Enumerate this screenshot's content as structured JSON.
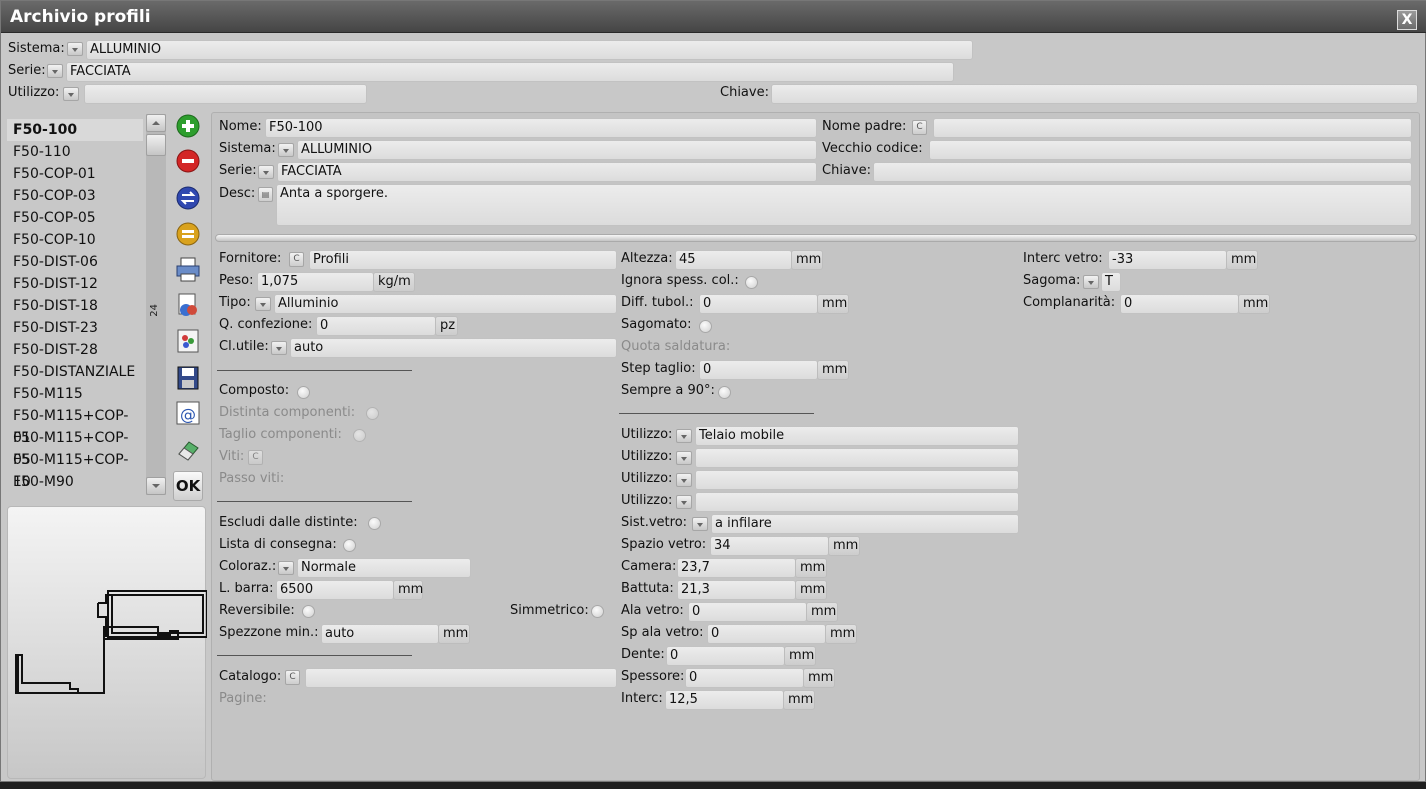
{
  "window": {
    "title": "Archivio profili",
    "close_glyph": "X"
  },
  "filters": {
    "sistema_label": "Sistema:",
    "sistema_value": "ALLUMINIO",
    "serie_label": "Serie:",
    "serie_value": "FACCIATA",
    "utilizzo_label": "Utilizzo:",
    "utilizzo_value": "",
    "chiave_label": "Chiave:",
    "chiave_value": ""
  },
  "list": {
    "items": [
      "F50-100",
      "F50-110",
      "F50-COP-01",
      "F50-COP-03",
      "F50-COP-05",
      "F50-COP-10",
      "F50-DIST-06",
      "F50-DIST-12",
      "F50-DIST-18",
      "F50-DIST-23",
      "F50-DIST-28",
      "F50-DISTANZIALE",
      "F50-M115",
      "F50-M115+COP-01",
      "F50-M115+COP-05",
      "F50-M115+COP-10",
      "F50-M90"
    ],
    "selected": "F50-100",
    "count": "24"
  },
  "toolbar": {
    "icons": [
      "add-icon",
      "delete-icon",
      "swap-icon",
      "minus-icon",
      "print-icon",
      "duplicate-icon",
      "palette-icon",
      "save-icon",
      "email-icon",
      "eraser-icon"
    ],
    "ok_label": "OK"
  },
  "header": {
    "nome_label": "Nome:",
    "nome_value": "F50-100",
    "nome_padre_label": "Nome padre:",
    "nome_padre_value": "",
    "sistema_label": "Sistema:",
    "sistema_value": "ALLUMINIO",
    "vecchio_codice_label": "Vecchio codice:",
    "vecchio_codice_value": "",
    "serie_label": "Serie:",
    "serie_value": "FACCIATA",
    "chiave_label": "Chiave:",
    "chiave_value": "",
    "desc_label": "Desc:",
    "desc_value": "Anta a sporgere."
  },
  "col1": {
    "fornitore_label": "Fornitore:",
    "fornitore_value": "Profili",
    "peso_label": "Peso:",
    "peso_value": "1,075",
    "peso_unit": "kg/m",
    "tipo_label": "Tipo:",
    "tipo_value": "Alluminio",
    "qconf_label": "Q. confezione:",
    "qconf_value": "0",
    "qconf_unit": "pz",
    "clutile_label": "Cl.utile:",
    "clutile_value": "auto",
    "composto_label": "Composto:",
    "distinta_label": "Distinta componenti:",
    "taglio_label": "Taglio componenti:",
    "viti_label": "Viti:",
    "passo_label": "Passo viti:",
    "escludi_label": "Escludi dalle distinte:",
    "lista_label": "Lista di consegna:",
    "coloraz_label": "Coloraz.:",
    "coloraz_value": "Normale",
    "lbarra_label": "L. barra:",
    "lbarra_value": "6500",
    "lbarra_unit": "mm",
    "reversibile_label": "Reversibile:",
    "simmetrico_label": "Simmetrico:",
    "spezzone_label": "Spezzone min.:",
    "spezzone_value": "auto",
    "spezzone_unit": "mm",
    "catalogo_label": "Catalogo:",
    "catalogo_value": "",
    "pagine_label": "Pagine:"
  },
  "col2": {
    "altezza_label": "Altezza:",
    "altezza_value": "45",
    "altezza_unit": "mm",
    "ignora_label": "Ignora spess. col.:",
    "diff_label": "Diff. tubol.:",
    "diff_value": "0",
    "diff_unit": "mm",
    "sagomato_label": "Sagomato:",
    "quota_label": "Quota saldatura:",
    "step_label": "Step taglio:",
    "step_value": "0",
    "step_unit": "mm",
    "sempre_label": "Sempre a 90°:",
    "utilizzo_label": "Utilizzo:",
    "utilizzo_values": [
      "Telaio mobile",
      "",
      "",
      ""
    ],
    "sistvetro_label": "Sist.vetro:",
    "sistvetro_value": "a infilare",
    "spazio_label": "Spazio vetro:",
    "spazio_value": "34",
    "camera_label": "Camera:",
    "camera_value": "23,7",
    "battuta_label": "Battuta:",
    "battuta_value": "21,3",
    "ala_label": "Ala vetro:",
    "ala_value": "0",
    "spala_label": "Sp ala vetro:",
    "spala_value": "0",
    "dente_label": "Dente:",
    "dente_value": "0",
    "spessore_label": "Spessore:",
    "spessore_value": "0",
    "interc_label": "Interc:",
    "interc_value": "12,5",
    "unit": "mm"
  },
  "col3": {
    "intercvetro_label": "Interc vetro:",
    "intercvetro_value": "-33",
    "intercvetro_unit": "mm",
    "sagoma_label": "Sagoma:",
    "sagoma_value": "T",
    "complanarita_label": "Complanarità:",
    "complanarita_value": "0",
    "complanarita_unit": "mm"
  }
}
